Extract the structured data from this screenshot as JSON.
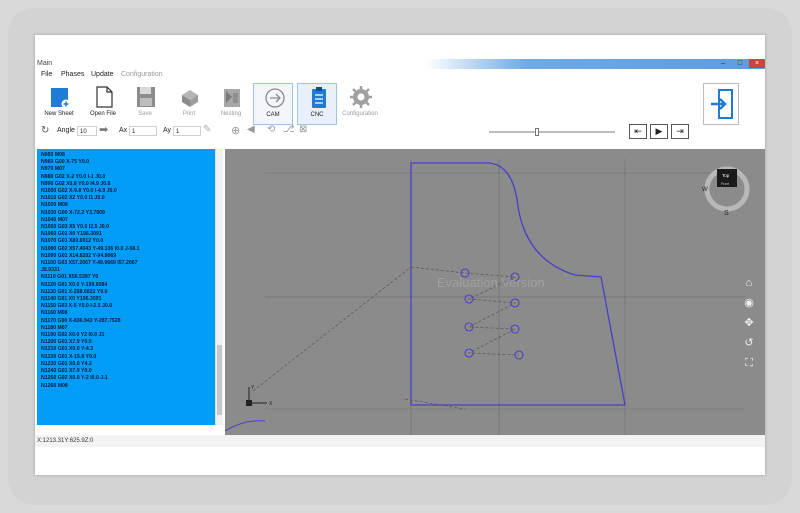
{
  "window": {
    "title": "Main",
    "controls": {
      "minimize": "–",
      "maximize": "□",
      "close": "×"
    }
  },
  "menu": {
    "file": "File",
    "phases": "Phases",
    "update": "Update",
    "configuration": "Configuration"
  },
  "ribbon": {
    "new_sheet": "New Sheet",
    "open_file": "Open File",
    "save": "Save",
    "print": "Print",
    "nesting": "Nesting",
    "cam": "CAM",
    "cnc": "CNC",
    "configuration": "Configuration"
  },
  "toolbar": {
    "angle_label": "Angle",
    "angle_value": "10",
    "ax_label": "Ax",
    "ax_value": "1",
    "ay_label": "Ay",
    "ay_value": "1",
    "slider_level": 0.38
  },
  "gcode_lines": [
    "N950 M08",
    "N960 G00 X-75 Y0.0",
    "N970 M07",
    "N980 G02 X-2  Y0.0 I-1 J0.0",
    "N990 G02 X0.8  Y0.0 I4.9 J0.0",
    "N1000 G02 X-9.8  Y0.0 I-4.9 J0.0",
    "N1010 G02 X2  Y0.0 I1 J0.0",
    "N1020 M08",
    "N1030 G00 X-72.2 Y3.7909",
    "N1040 M07",
    "N1050 G03 X5  Y0.0 I2.5 J0.0",
    "N1060 G01 X0 Y196.3091",
    "N1070 G01 X80.6912 Y0.0",
    "N1080 G02 X57.4043  Y-49.136 I0.0 J-58.1",
    "N1090 G01 X14.8202 Y-94.9069",
    "N1100 G03 X57.2067  Y-49.9669 I57.2067",
    "J8.9331",
    "N1110 G01 X56.5397 Y0",
    "N1120 G01 X0.0 Y-199.6084",
    "N1130 G01 X-288.6822 Y0.0",
    "N1140 G01 X0 Y196.3091",
    "N1150 G03 X-5 Y0.0 I-2.5 J0.0",
    "N1160 M08",
    "N1170 G00 X-836.943 Y-287.7528",
    "N1180 M07",
    "N1190 G02 X0.0  Y2 I0.0 J1",
    "N1200 G01 X7.9 Y0.0",
    "N1210 G01 X0.0 Y-4.3",
    "N1220 G01 X-15.8 Y0.0",
    "N1230 G01 X0.0 Y4.3",
    "N1240 G01 X7.9 Y0.0",
    "N1250 G02 X0.0  Y-2 I0.0 J-1",
    "N1260 M08"
  ],
  "canvas": {
    "watermark": "Evaluation Version",
    "cube_top": "Top",
    "cube_front": "Front",
    "compass_w": "W",
    "compass_s": "S",
    "axis_x": "X",
    "axis_y": "Y"
  },
  "status": {
    "coords": "X:1213.31Y:625.9Z:0"
  },
  "colors": {
    "panel_blue": "#009cf5",
    "canvas_gray": "#8b8b8b",
    "part_outline": "#4a3fc8",
    "accent": "#1f7bd6"
  }
}
